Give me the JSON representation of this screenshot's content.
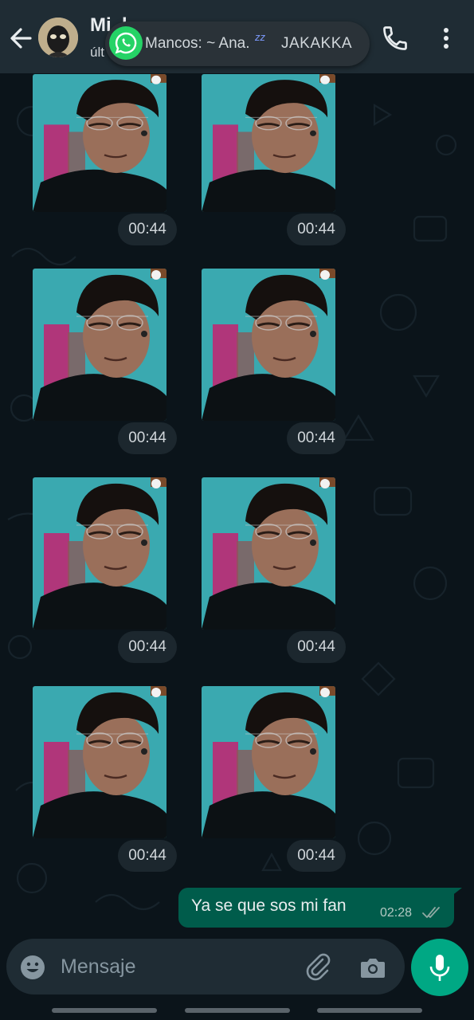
{
  "header": {
    "contact_name": "Mi..l..",
    "contact_status": "últ",
    "back_icon": "arrow-left-icon",
    "call_icon": "phone-icon",
    "menu_icon": "more-vertical-icon"
  },
  "notification": {
    "app_icon": "whatsapp-icon",
    "sender": "Mancos: ~ Ana.",
    "sleep_mark": "zz",
    "message": "JAKAKKA"
  },
  "photos": [
    {
      "time": "00:44"
    },
    {
      "time": "00:44"
    },
    {
      "time": "00:44"
    },
    {
      "time": "00:44"
    },
    {
      "time": "00:44"
    },
    {
      "time": "00:44"
    },
    {
      "time": "00:44"
    },
    {
      "time": "00:44"
    }
  ],
  "outgoing": {
    "text": "Ya se que sos mi fan",
    "time": "02:28",
    "status_icon": "double-check-icon"
  },
  "composer": {
    "placeholder": "Mensaje",
    "emoji_icon": "emoji-icon",
    "attach_icon": "paperclip-icon",
    "camera_icon": "camera-icon",
    "mic_icon": "microphone-icon"
  },
  "colors": {
    "header_bg": "#1f2c34",
    "chat_bg": "#0b141a",
    "outgoing_bubble": "#005c4b",
    "accent": "#00a884"
  }
}
